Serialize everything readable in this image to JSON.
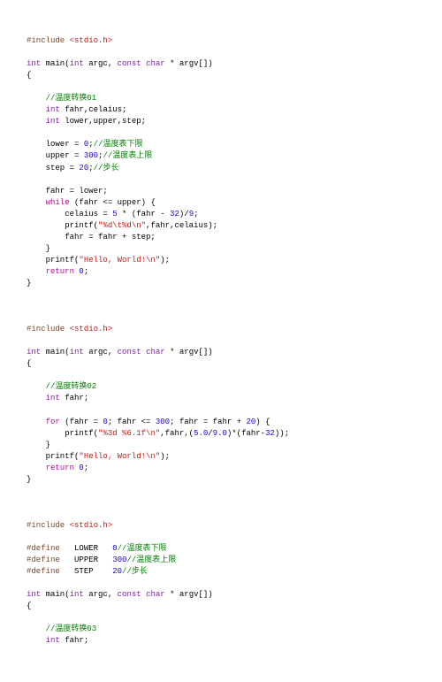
{
  "block1": {
    "include_kw": "#include",
    "include_arg": "<stdio.h>",
    "type_int": "int",
    "main": "main",
    "arg_int": "int",
    "argc": "argc",
    "const": "const",
    "char": "char",
    "argv": "argv[]",
    "c_title": "//温度转换01",
    "decl1_t": "int",
    "decl1_v": "fahr,celaius;",
    "decl2_t": "int",
    "decl2_v": "lower,upper,step;",
    "lower_name": "lower = ",
    "lower_val": "0",
    "lower_c": "//温度表下限",
    "upper_name": "upper = ",
    "upper_val": "300",
    "upper_c": "//温度表上限",
    "step_name": "step = ",
    "step_val": "20",
    "step_c": "//步长",
    "l_fahr": "fahr = lower;",
    "kw_while": "while",
    "while_cond": " (fahr <= upper) {",
    "calc_a": "celaius = ",
    "calc_5": "5",
    "calc_b": " * (fahr - ",
    "calc_32": "32",
    "calc_c": ")/",
    "calc_9": "9",
    "printf1_a": "printf",
    "printf1_b": "(",
    "printf1_s": "\"%d\\t%d\\n\"",
    "printf1_c": ",fahr,celaius);",
    "l_inc": "fahr = fahr + step;",
    "brace_close": "}",
    "printf2_a": "printf",
    "printf2_b": "(",
    "printf2_s": "\"Hello, World!\\n\"",
    "printf2_c": ");",
    "kw_return": "return",
    "ret0": "0"
  },
  "block2": {
    "include_kw": "#include",
    "include_arg": "<stdio.h>",
    "type_int": "int",
    "main": "main",
    "arg_int": "int",
    "argc": "argc",
    "const": "const",
    "char": "char",
    "argv": "argv[]",
    "c_title": "//温度转换02",
    "decl_t": "int",
    "decl_v": "fahr;",
    "kw_for": "for",
    "for_a": " (fahr = ",
    "for_0": "0",
    "for_b": "; fahr <= ",
    "for_300": "300",
    "for_c": "; fahr = fahr + ",
    "for_20": "20",
    "for_d": ") {",
    "p_a": "printf",
    "p_b": "(",
    "p_s": "\"%3d %6.1f\\n\"",
    "p_c": ",fahr,(",
    "p_5": "5.0",
    "p_d": "/",
    "p_9": "9.0",
    "p_e": ")*(fahr-",
    "p_32": "32",
    "p_f": "));",
    "brace_close": "}",
    "p2_a": "printf",
    "p2_b": "(",
    "p2_s": "\"Hello, World!\\n\"",
    "p2_c": ");",
    "kw_return": "return",
    "ret0": "0"
  },
  "block3": {
    "include_kw": "#include",
    "include_arg": "<stdio.h>",
    "def_kw": "#define",
    "d1_n": "LOWER",
    "d1_v": "0",
    "d1_c": "//温度表下限",
    "d2_n": "UPPER",
    "d2_v": "300",
    "d2_c": "//温度表上限",
    "d3_n": "STEP",
    "d3_v": "20",
    "d3_c": "//步长",
    "type_int": "int",
    "main": "main",
    "arg_int": "int",
    "argc": "argc",
    "const": "const",
    "char": "char",
    "argv": "argv[]",
    "c_title": "//温度转换03",
    "decl_t": "int",
    "decl_v": "fahr;"
  }
}
